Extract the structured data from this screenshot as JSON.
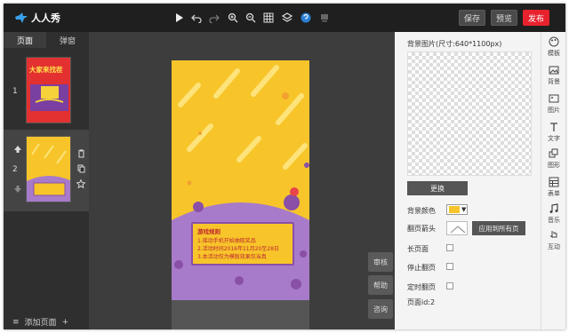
{
  "app": {
    "name": "人人秀"
  },
  "toolbar": {
    "save": "保存",
    "preview": "预览",
    "publish": "发布"
  },
  "left_panel": {
    "tabs": [
      "页面",
      "弹窗"
    ],
    "pages": [
      {
        "number": "1",
        "thumb_text": "大家来找茬"
      },
      {
        "number": "2"
      }
    ],
    "add_page": "添加页面"
  },
  "canvas": {
    "rules": {
      "title": "游戏规则",
      "lines": [
        "1.摇动手机开始抽取奖品",
        "2.活动时间2016年11月20至28日",
        "3.本活动仅为模版效果仅当真"
      ]
    },
    "side_buttons": [
      "审核",
      "帮助",
      "咨询"
    ]
  },
  "properties": {
    "bg_image_label": "背景图片(尺寸:640*1100px)",
    "replace_button": "更换",
    "bg_color_label": "背景颜色",
    "bg_color_value": "#f7c52a",
    "flip_label": "翻页箭头",
    "apply_all_button": "应用到所有页",
    "long_page_label": "长页面",
    "stop_flip_label": "停止翻页",
    "timed_flip_label": "定时翻页",
    "page_id": "页面id:2"
  },
  "right_tools": [
    "模板",
    "背景",
    "图片",
    "文字",
    "图形",
    "表单",
    "音乐",
    "互动"
  ],
  "colors": {
    "accent_red": "#e8222d",
    "canvas_yellow": "#f7c52a",
    "purple": "#9b6bbf"
  }
}
